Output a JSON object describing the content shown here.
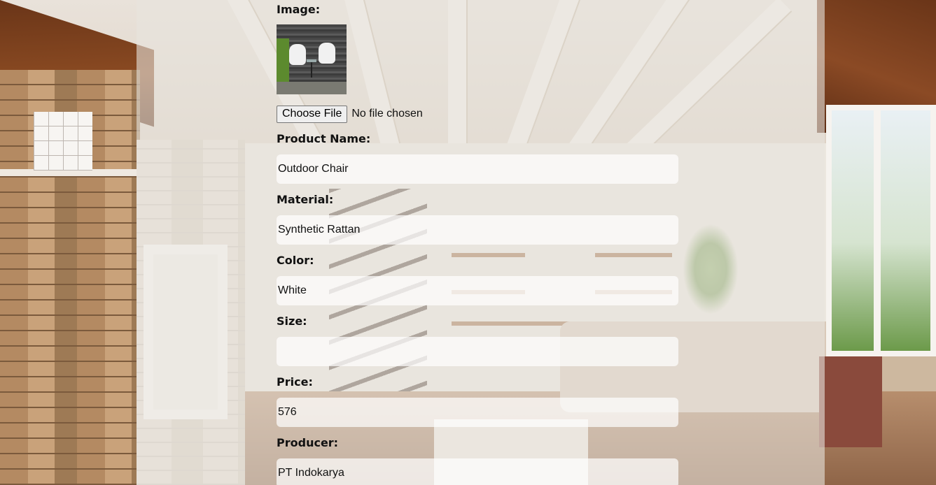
{
  "form": {
    "image_label": "Image:",
    "file_button": "Choose File",
    "file_status": "No file chosen",
    "product_name_label": "Product Name:",
    "product_name_value": "Outdoor Chair",
    "material_label": "Material:",
    "material_value": "Synthetic Rattan",
    "color_label": "Color:",
    "color_value": "White",
    "size_label": "Size:",
    "size_value": "",
    "price_label": "Price:",
    "price_value": "576",
    "producer_label": "Producer:",
    "producer_value": "PT Indokarya"
  },
  "icons": {
    "product_image": "product-thumbnail-image"
  },
  "colors": {
    "panel_overlay": "#e8e4de",
    "field_background": "#ffffff",
    "label_text": "#111111"
  }
}
